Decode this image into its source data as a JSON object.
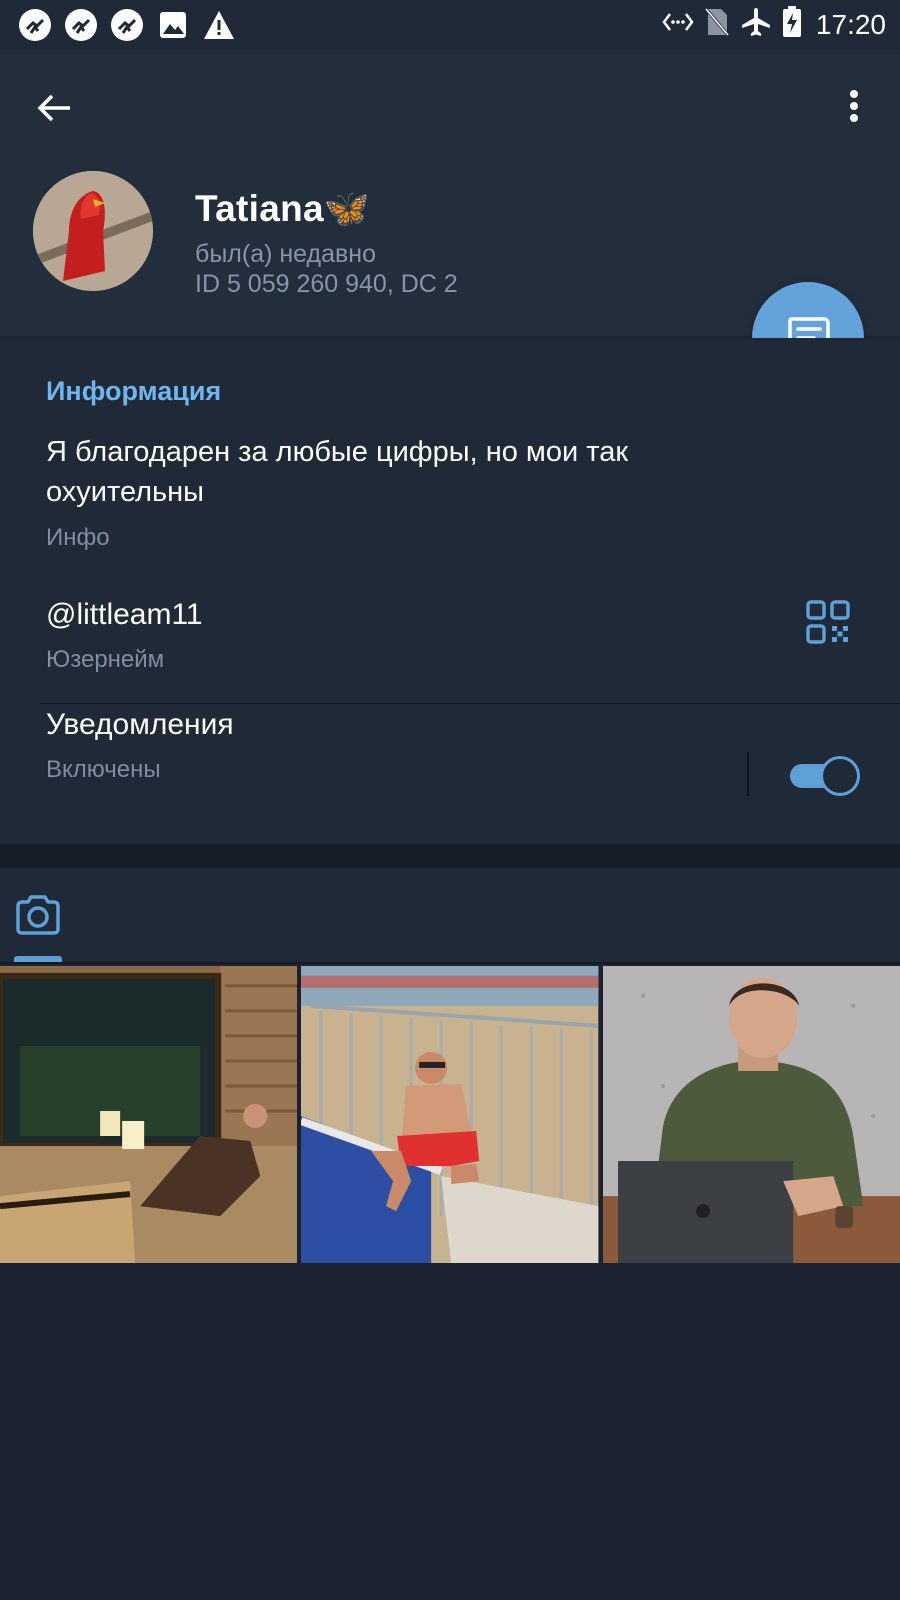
{
  "status_bar": {
    "time": "17:20",
    "left_icons": [
      "app-notification-icon",
      "app-notification-icon",
      "app-notification-icon",
      "image-icon",
      "warning-icon"
    ],
    "right_icons": [
      "nfc-icon",
      "no-sim-icon",
      "airplane-icon",
      "battery-charging-icon"
    ]
  },
  "header": {
    "name": "Tatiana🦋",
    "status": "был(а) недавно",
    "id_line": "ID 5 059 260 940, DC 2"
  },
  "info": {
    "section_title": "Информация",
    "bio": "Я благодарен за любые цифры, но мои так охуительны",
    "bio_caption": "Инфо",
    "username": "@littleam11",
    "username_caption": "Юзернейм",
    "notifications_label": "Уведомления",
    "notifications_caption": "Включены",
    "notifications_on": true
  },
  "media": {
    "active_tab": "photos",
    "photos": [
      {
        "name": "photo-sauna"
      },
      {
        "name": "photo-pool"
      },
      {
        "name": "photo-laptop"
      }
    ]
  },
  "colors": {
    "accent": "#62a3dc",
    "link": "#6fb5ee",
    "background": "#1c2330",
    "surface": "#1f2937"
  }
}
